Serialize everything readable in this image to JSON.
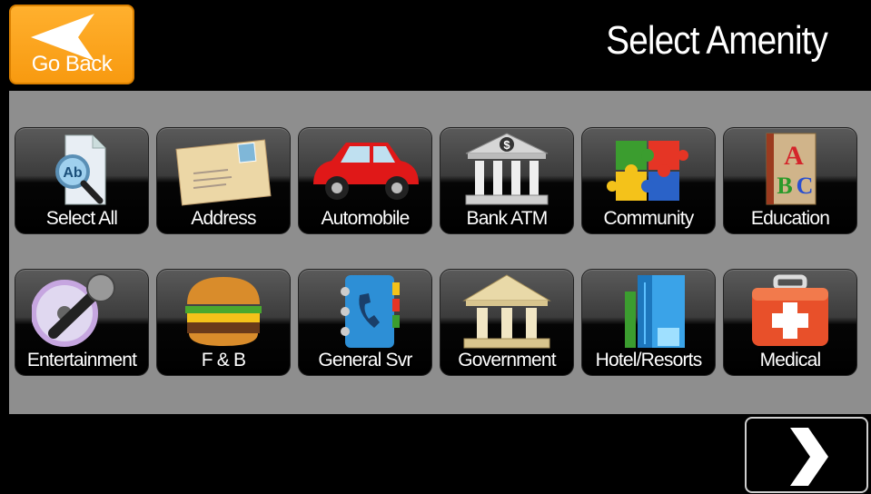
{
  "header": {
    "back_label": "Go Back",
    "title": "Select Amenity"
  },
  "amenities": [
    {
      "label": "Select All",
      "icon": "magnifier-document-icon"
    },
    {
      "label": "Address",
      "icon": "envelope-icon"
    },
    {
      "label": "Automobile",
      "icon": "car-icon"
    },
    {
      "label": "Bank ATM",
      "icon": "bank-icon"
    },
    {
      "label": "Community",
      "icon": "puzzle-icon"
    },
    {
      "label": "Education",
      "icon": "abc-book-icon"
    },
    {
      "label": "Entertainment",
      "icon": "microphone-icon"
    },
    {
      "label": "F & B",
      "icon": "burger-icon"
    },
    {
      "label": "General Svr",
      "icon": "phone-book-icon"
    },
    {
      "label": "Government",
      "icon": "government-building-icon"
    },
    {
      "label": "Hotel/Resorts",
      "icon": "hotel-icon"
    },
    {
      "label": "Medical",
      "icon": "medical-kit-icon"
    }
  ],
  "footer": {
    "next_icon": "chevron-right-icon"
  },
  "colors": {
    "back_button": "#f89a10",
    "panel": "#8e8e8e",
    "background": "#000000"
  }
}
